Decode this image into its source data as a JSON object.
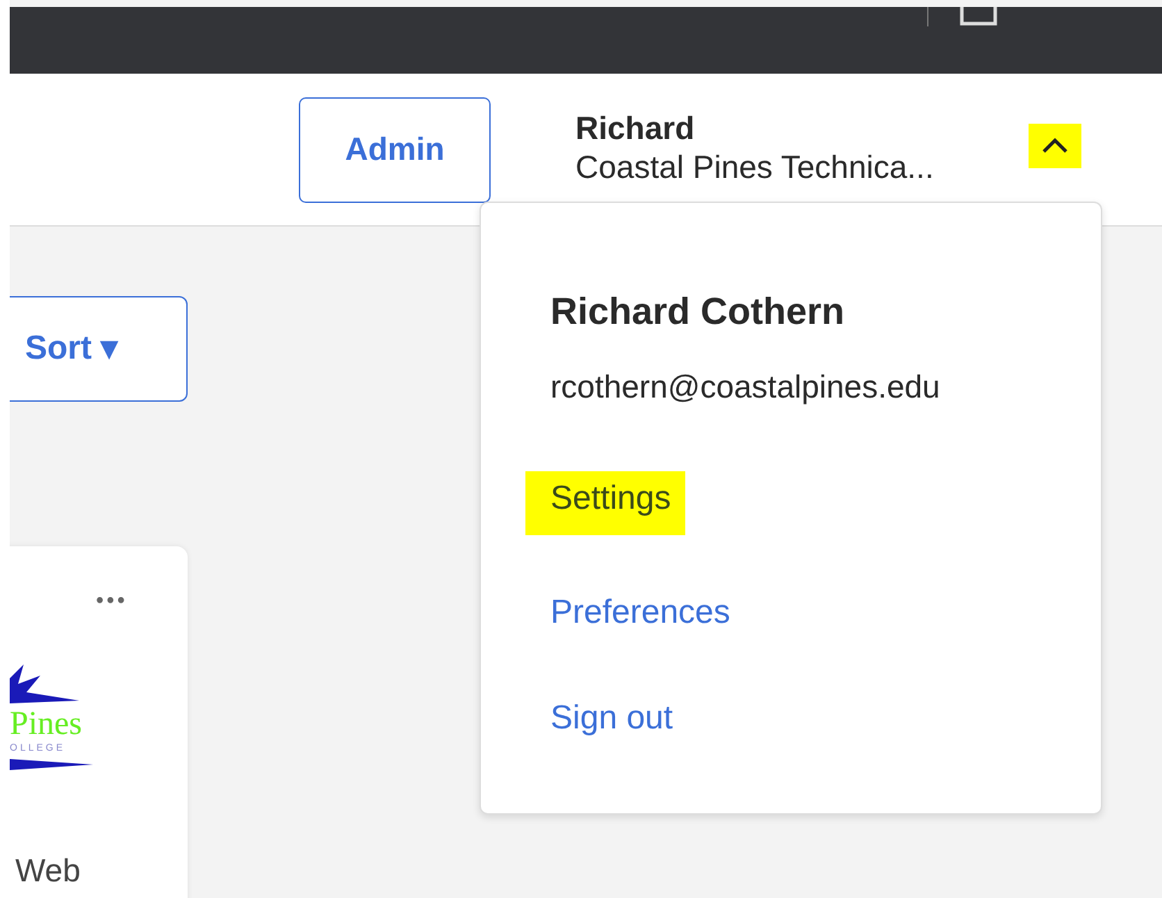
{
  "header": {
    "admin_button": "Admin",
    "user_name": "Richard",
    "org_name": "Coastal Pines Technica...",
    "menu_expanded": true,
    "caret_highlighted": true
  },
  "toolbar": {
    "sort_button": "Sort ▾"
  },
  "card": {
    "more": "•••",
    "logo_word": "Pines",
    "logo_sub": "OLLEGE",
    "caption": "Web"
  },
  "user_menu": {
    "full_name": "Richard Cothern",
    "email": "rcothern@coastalpines.edu",
    "items": [
      {
        "label": "Settings",
        "highlighted": true
      },
      {
        "label": "Preferences",
        "highlighted": false
      },
      {
        "label": "Sign out",
        "highlighted": false
      }
    ]
  }
}
